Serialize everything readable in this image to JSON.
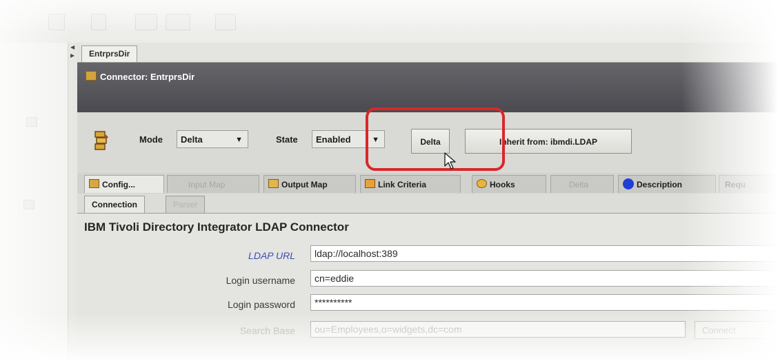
{
  "toolbar": {
    "icons": [
      "new-icon",
      "open-icon",
      "save-icon",
      "run-icon",
      "console-icon"
    ]
  },
  "document_tab": {
    "label": "EntrprsDir"
  },
  "title_bar": {
    "title": "Connector: EntrprsDir",
    "icon": "connector-icon"
  },
  "mode_row": {
    "mode_label": "Mode",
    "mode_value": "Delta",
    "state_label": "State",
    "state_value": "Enabled",
    "delta_button": "Delta",
    "inherit_button": "Inherit from: ibmdi.LDAP",
    "highlight_color": "#d9272a"
  },
  "tabs": {
    "config": "Config...",
    "input_map": "Input Map",
    "output_map": "Output Map",
    "link_criteria": "Link Criteria",
    "hooks": "Hooks",
    "delta": "Delta",
    "description": "Description",
    "requires": "Requ"
  },
  "sub_tabs": {
    "connection": "Connection",
    "parser": "Parser"
  },
  "form": {
    "heading": "IBM Tivoli Directory Integrator LDAP Connector",
    "ldap_url_label": "LDAP URL",
    "ldap_url_value": "ldap://localhost:389",
    "login_username_label": "Login username",
    "login_username_value": "cn=eddie",
    "login_password_label": "Login password",
    "login_password_value": "**********",
    "search_base_label": "Search Base",
    "search_base_value": "ou=Employees,o=widgets,dc=com",
    "connect_button": "Connect"
  }
}
